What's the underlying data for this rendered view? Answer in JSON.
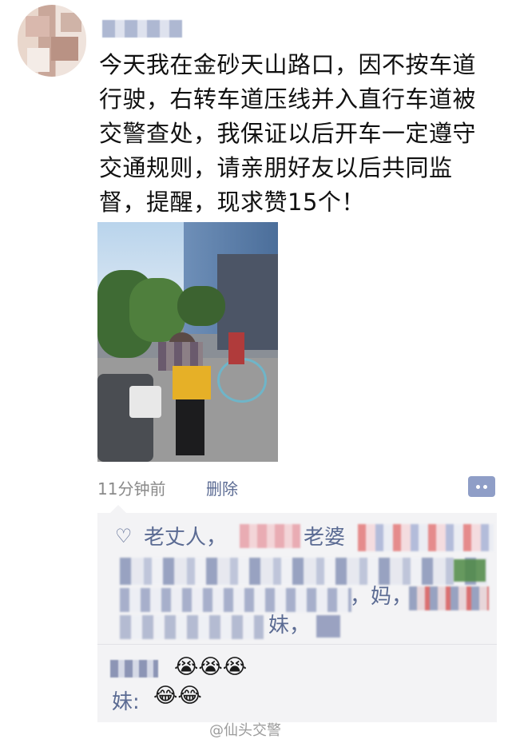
{
  "post": {
    "text": "今天我在金砂天山路口，因不按车道行驶，右转车道压线并入直行车道被交警查处，我保证以后开车一定遵守交通规则，请亲朋好友以后共同监督，提醒，现求赞15个！",
    "time": "11分钟前",
    "delete_label": "删除"
  },
  "likes": {
    "name1": "老丈人，",
    "name2": "老婆",
    "name3": "，妈，",
    "name4": "妹，"
  },
  "comments": {
    "comment1_emoji": "😭😭😭",
    "comment2_author": "妹:",
    "comment2_emoji": "😂😂"
  },
  "watermark": "@仙头交警",
  "icons": {
    "like": "heart-outline-icon",
    "comment": "comment-dots-icon"
  }
}
